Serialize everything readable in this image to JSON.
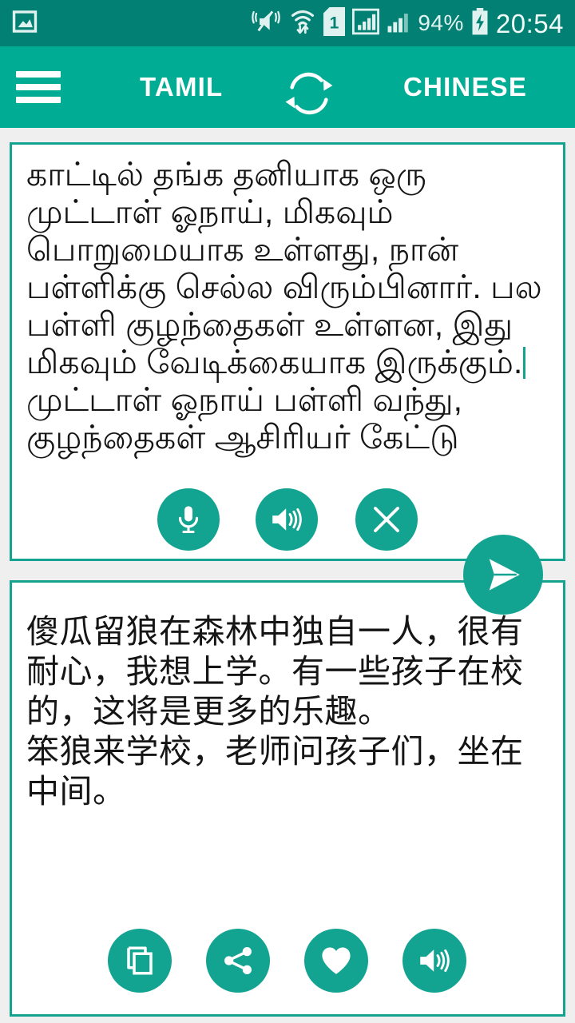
{
  "statusbar": {
    "notification_icon": "screenshot-image-icon",
    "icons": [
      "vibrate-mute-icon",
      "wifi-transfer-icon",
      "sim-1-icon",
      "signal-bars-sim1-icon",
      "signal-bars-sim2-icon"
    ],
    "sim_label": "1",
    "battery_percent": "94%",
    "battery_state": "charging",
    "clock": "20:54",
    "bg_color": "#018073",
    "fg_color": "#e3f3f0"
  },
  "appbar": {
    "menu_icon": "hamburger-menu-icon",
    "source_language": "TAMIL",
    "swap_icon": "swap-languages-icon",
    "target_language": "CHINESE",
    "bg_color": "#00ac94"
  },
  "source_panel": {
    "text": "காட்டில் தங்க தனியாக ஒரு முட்டாள் ஓநாய், மிகவும் பொறுமையாக உள்ளது, நான் பள்ளிக்கு செல்ல விரும்பினார். பல பள்ளி குழந்தைகள் உள்ளன, இது மிகவும் வேடிக்கையாக இருக்கும்.",
    "text_overflow": "முட்டாள் ஓநாய் பள்ளி வந்து, குழந்தைகள் ஆசிரியர் கேட்டு",
    "caret_visible": true,
    "border_color": "#14a391",
    "actions": [
      {
        "name": "voice-input-button",
        "icon": "microphone-icon"
      },
      {
        "name": "speak-source-button",
        "icon": "speaker-icon"
      },
      {
        "name": "clear-text-button",
        "icon": "close-x-icon"
      }
    ],
    "send": {
      "name": "translate-send-button",
      "icon": "send-paper-plane-icon"
    }
  },
  "target_panel": {
    "text": "傻瓜留狼在森林中独自一人，很有耐心，我想上学。有一些孩子在校的，这将是更多的乐趣。\n笨狼来学校，老师问孩子们，坐在中间。",
    "border_color": "#14a391",
    "actions": [
      {
        "name": "copy-button",
        "icon": "copy-icon"
      },
      {
        "name": "share-button",
        "icon": "share-icon"
      },
      {
        "name": "favorite-button",
        "icon": "heart-icon"
      },
      {
        "name": "speak-target-button",
        "icon": "speaker-icon"
      }
    ]
  },
  "theme": {
    "accent": "#00ac94",
    "accent_dark": "#018073",
    "button": "#13a491",
    "page_bg": "#efefef"
  }
}
